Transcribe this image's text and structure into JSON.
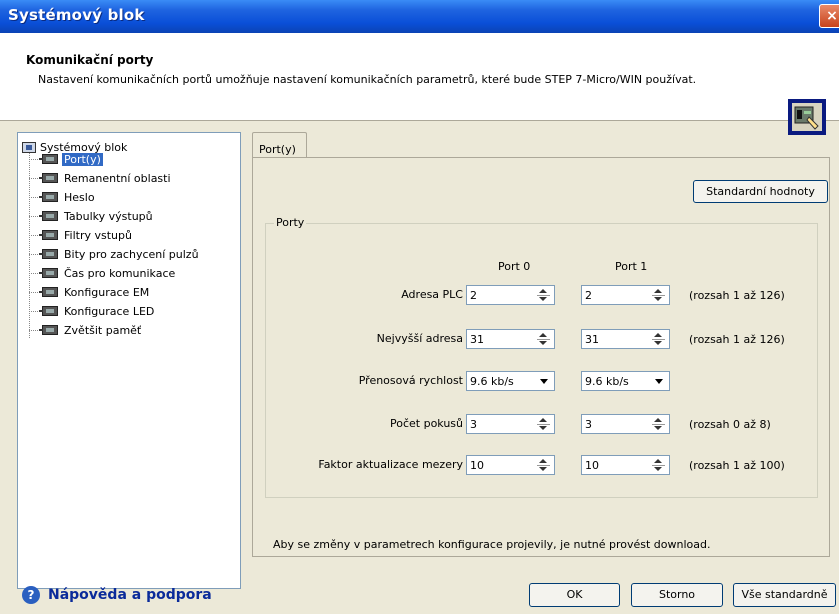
{
  "window": {
    "title": "Systémový blok",
    "close_label": "×"
  },
  "header": {
    "title": "Komunikační porty",
    "description": "Nastavení komunikačních portů umožňuje nastavení komunikačních parametrů, které bude STEP 7-Micro/WIN používat."
  },
  "tree": {
    "root": "Systémový blok",
    "items": [
      "Port(y)",
      "Remanentní oblasti",
      "Heslo",
      "Tabulky výstupů",
      "Filtry vstupů",
      "Bity pro zachycení pulzů",
      "Čas pro komunikace",
      "Konfigurace EM",
      "Konfigurace LED",
      "Zvětšit paměť"
    ],
    "selected_index": 0
  },
  "tab": {
    "label": "Port(y)"
  },
  "buttons": {
    "defaults": "Standardní hodnoty",
    "ok": "OK",
    "cancel": "Storno",
    "all_defaults": "Vše standardně"
  },
  "ports": {
    "group_label": "Porty",
    "col0": "Port 0",
    "col1": "Port 1",
    "rows": [
      {
        "label": "Adresa PLC",
        "port0": "2",
        "port1": "2",
        "range": "(rozsah 1 až 126)"
      },
      {
        "label": "Nejvyšší adresa",
        "port0": "31",
        "port1": "31",
        "range": "(rozsah 1 až 126)"
      },
      {
        "label": "Přenosová rychlost",
        "port0": "9.6 kb/s",
        "port1": "9.6 kb/s",
        "range": ""
      },
      {
        "label": "Počet pokusů",
        "port0": "3",
        "port1": "3",
        "range": "(rozsah 0 až 8)"
      },
      {
        "label": "Faktor aktualizace mezery",
        "port0": "10",
        "port1": "10",
        "range": "(rozsah 1 až 100)"
      }
    ]
  },
  "note": "Aby se změny v parametrech konfigurace projevily, je nutné provést download.",
  "help": {
    "label": "Nápověda a podpora"
  }
}
